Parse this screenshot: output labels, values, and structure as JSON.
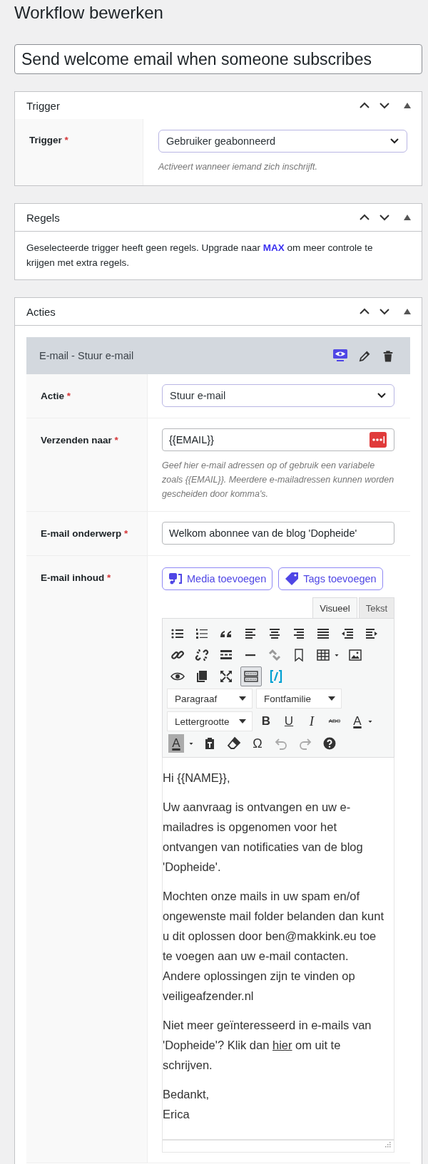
{
  "page_title": "Workflow bewerken",
  "workflow_name": "Send welcome email when someone subscribes",
  "trigger": {
    "title": "Trigger",
    "label": "Trigger",
    "required_mark": "*",
    "value": "Gebruiker geabonneerd",
    "hint": "Activeert wanneer iemand zich inschrijft."
  },
  "rules": {
    "title": "Regels",
    "text": "Geselecteerde trigger heeft geen regels. Upgrade naar **MAX** om meer controle te krijgen met extra regels."
  },
  "actions": {
    "title": "Acties",
    "action_title": "E-mail - Stuur e-mail",
    "fields": [
      {
        "kind": "select",
        "label": "Actie",
        "required_mark": "*",
        "value": "Stuur e-mail"
      },
      {
        "kind": "email",
        "label": "Verzenden naar",
        "required_mark": "*",
        "value": "{{EMAIL}}",
        "hint": "Geef hier e-mail adressen op of gebruik een variabele zoals {{EMAIL}}. Meerdere e-mailadressen kunnen worden gescheiden door komma's."
      },
      {
        "kind": "text",
        "label": "E-mail onderwerp",
        "required_mark": "*",
        "value": "Welkom abonnee van de blog 'Dopheide'"
      },
      {
        "kind": "editor",
        "label": "E-mail inhoud",
        "required_mark": "*"
      }
    ]
  },
  "editor": {
    "buttons": [
      {
        "kind": "media",
        "label": "Media toevoegen"
      },
      {
        "kind": "tags",
        "label": "Tags toevoegen"
      }
    ],
    "tabs": [
      {
        "label": "Visueel",
        "selected": true
      },
      {
        "label": "Tekst",
        "selected": false
      }
    ],
    "toolbar_toggle_selected": true,
    "selects": [
      "Paragraaf",
      "Fontfamilie",
      "Lettergrootte"
    ],
    "glyphs": [
      {
        "kind": "bold",
        "glyph": "B"
      },
      {
        "kind": "underline",
        "glyph": "U"
      },
      {
        "kind": "italic",
        "glyph": "I"
      },
      {
        "kind": "strike",
        "glyph": "ABC"
      },
      {
        "kind": "text-color",
        "glyph": "A"
      },
      {
        "kind": "bg-color",
        "glyph": "A"
      },
      {
        "kind": "special-char",
        "glyph": "Ω"
      }
    ],
    "paragraphs": [
      {
        "kind": "text",
        "text": "Hi {{NAME}},"
      },
      {
        "kind": "text",
        "text": "Uw aanvraag is ontvangen en uw e-mailadres is opgenomen voor het ontvangen van notificaties van de blog 'Dopheide'."
      },
      {
        "kind": "text",
        "text": "Mochten onze mails in uw spam en/of ongewenste mail folder belanden dan kunt u dit oplossen door ben@makkink.eu toe te voegen aan uw e-mail contacten. Andere oplossingen zijn te vinden op veiligeafzender.nl"
      },
      {
        "kind": "link",
        "before": "Niet meer geïnteresseerd in e-mails van 'Dopheide'? Klik dan ",
        "link": "hier",
        "after": " om uit te schrijven."
      },
      {
        "kind": "lines",
        "lines": [
          "Bedankt,",
          "Erica"
        ]
      }
    ]
  }
}
